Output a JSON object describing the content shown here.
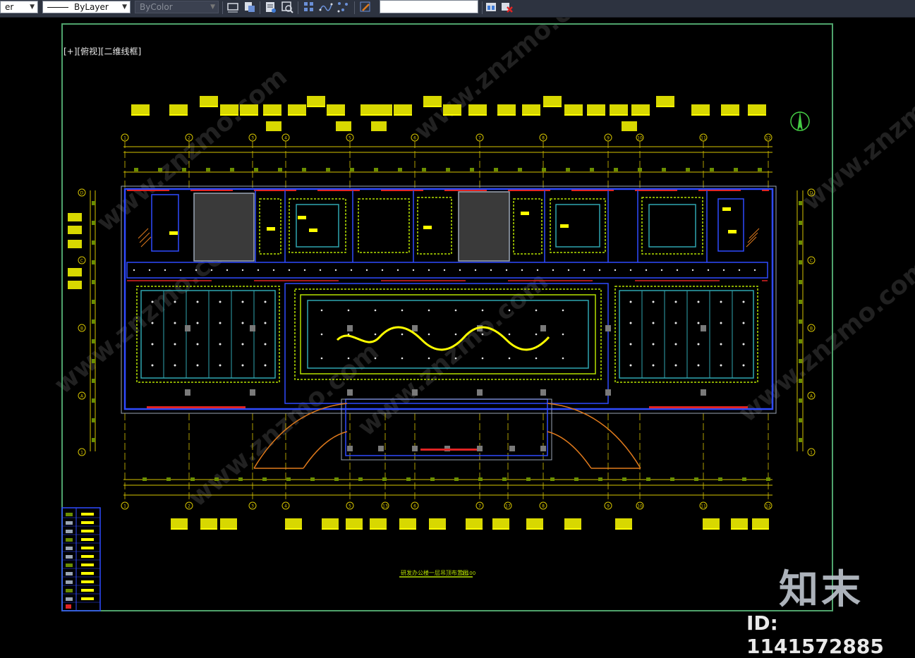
{
  "toolbar": {
    "layer_combo_value": "er",
    "linetype_combo_value": "ByLayer",
    "color_combo_value": "ByColor",
    "command_input_value": ""
  },
  "viewport": {
    "label": "[+][俯视][二维线框]"
  },
  "drawing": {
    "grid_top": [
      "1",
      "2",
      "3",
      "4",
      "5",
      "6",
      "7",
      "8",
      "9",
      "10",
      "11",
      "12"
    ],
    "grid_bottom": [
      "1",
      "2",
      "3",
      "4",
      "5",
      "13",
      "6",
      "7",
      "17",
      "8",
      "9",
      "10",
      "11",
      "12"
    ],
    "grid_left": [
      "D",
      "C",
      "B",
      "A",
      "1"
    ],
    "grid_right": [
      "D",
      "C",
      "B",
      "A",
      "1"
    ],
    "title_block": "研发办公楼一层吊顶布置图",
    "scale_label": "1:100"
  },
  "watermark": {
    "site": "www.znzmo.com",
    "logo_text": "知末",
    "id_text": "ID: 1141572885"
  },
  "colors": {
    "background": "#000000",
    "toolbar_bg": "#2d3340",
    "frame": "#4fa36c",
    "wall_blue": "#2f4bff",
    "wall_red": "#e02424",
    "dim_yellow": "#d6c400",
    "ceiling_green": "#b6e000",
    "tag_yellow": "#ffff00",
    "orange": "#e07a1c"
  }
}
